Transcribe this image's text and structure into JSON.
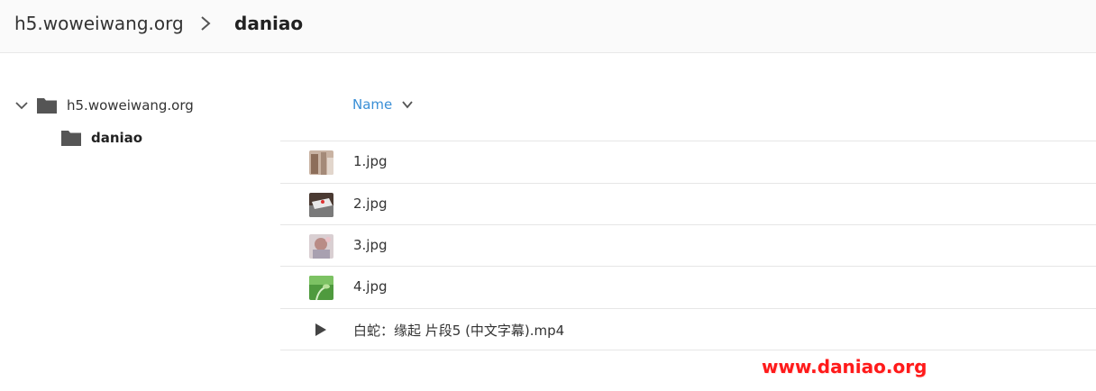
{
  "breadcrumb": {
    "root": "h5.woweiwang.org",
    "current": "daniao"
  },
  "sidebar": {
    "items": [
      {
        "label": "h5.woweiwang.org",
        "expanded": true,
        "icon": "folder-icon"
      },
      {
        "label": "daniao",
        "selected": true,
        "icon": "folder-icon"
      }
    ]
  },
  "list": {
    "sort_label": "Name",
    "files": [
      {
        "name": "1.jpg",
        "type": "image",
        "icon": "image-thumbnail"
      },
      {
        "name": "2.jpg",
        "type": "image",
        "icon": "image-thumbnail"
      },
      {
        "name": "3.jpg",
        "type": "image",
        "icon": "image-thumbnail"
      },
      {
        "name": "4.jpg",
        "type": "image",
        "icon": "image-thumbnail"
      },
      {
        "name": "白蛇：缘起 片段5 (中文字幕).mp4",
        "type": "video",
        "icon": "play-icon"
      }
    ]
  },
  "watermark": "www.daniao.org",
  "colors": {
    "accent": "#3a8fd6",
    "watermark": "#ff1a1a",
    "folder": "#555555"
  }
}
